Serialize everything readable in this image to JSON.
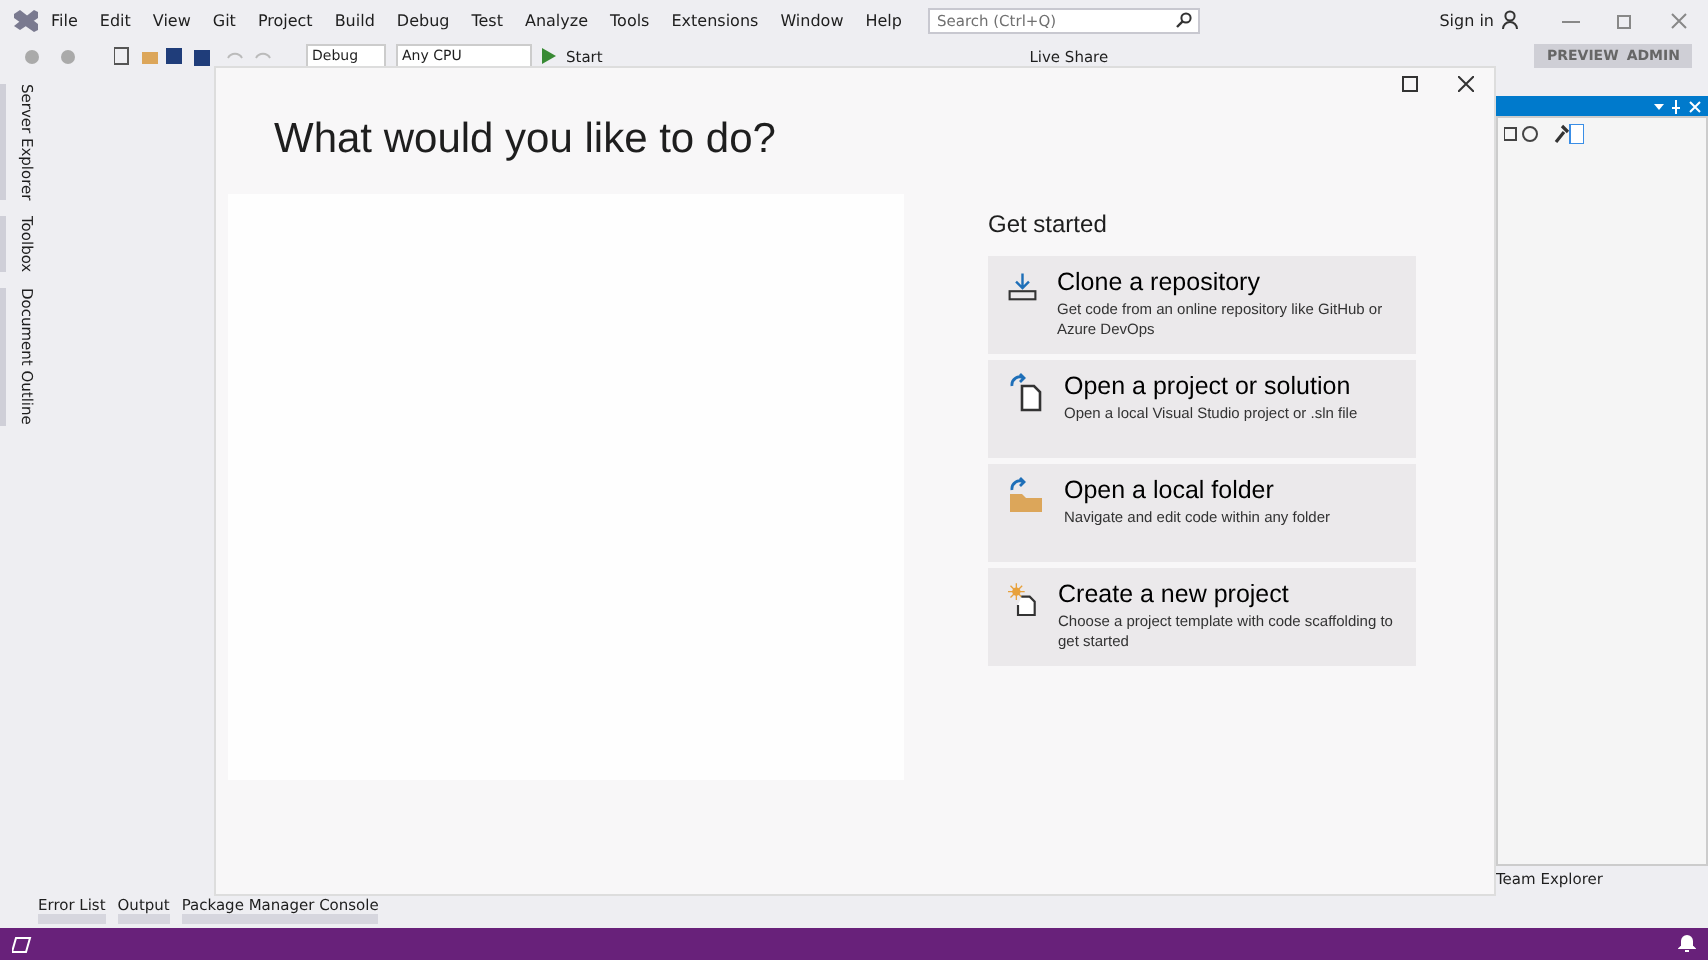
{
  "menu": [
    "File",
    "Edit",
    "View",
    "Git",
    "Project",
    "Build",
    "Debug",
    "Test",
    "Analyze",
    "Tools",
    "Extensions",
    "Window",
    "Help"
  ],
  "search": {
    "placeholder": "Search (Ctrl+Q)"
  },
  "sign_in": "Sign in",
  "toolbar": {
    "configuration": "Debug",
    "platform": "Any CPU",
    "start": "Start",
    "live_share": "Live Share"
  },
  "badge": [
    "PREVIEW",
    "ADMIN"
  ],
  "left_tabs": [
    "Server Explorer",
    "Toolbox",
    "Document Outline"
  ],
  "dialog": {
    "title": "What would you like to do?",
    "heading": "Get started",
    "actions": [
      {
        "kind": "clone",
        "title": "Clone a repository",
        "description": "Get code from an online repository like GitHub or Azure DevOps"
      },
      {
        "kind": "project",
        "title": "Open a project or solution",
        "description": "Open a local Visual Studio project or .sln file"
      },
      {
        "kind": "folder",
        "title": "Open a local folder",
        "description": "Navigate and edit code within any folder"
      },
      {
        "kind": "new",
        "title": "Create a new project",
        "description": "Choose a project template with code scaffolding to get started"
      }
    ]
  },
  "right_panel": {
    "tab": "Team Explorer"
  },
  "bottom_tabs": [
    "Error List",
    "Output",
    "Package Manager Console"
  ]
}
